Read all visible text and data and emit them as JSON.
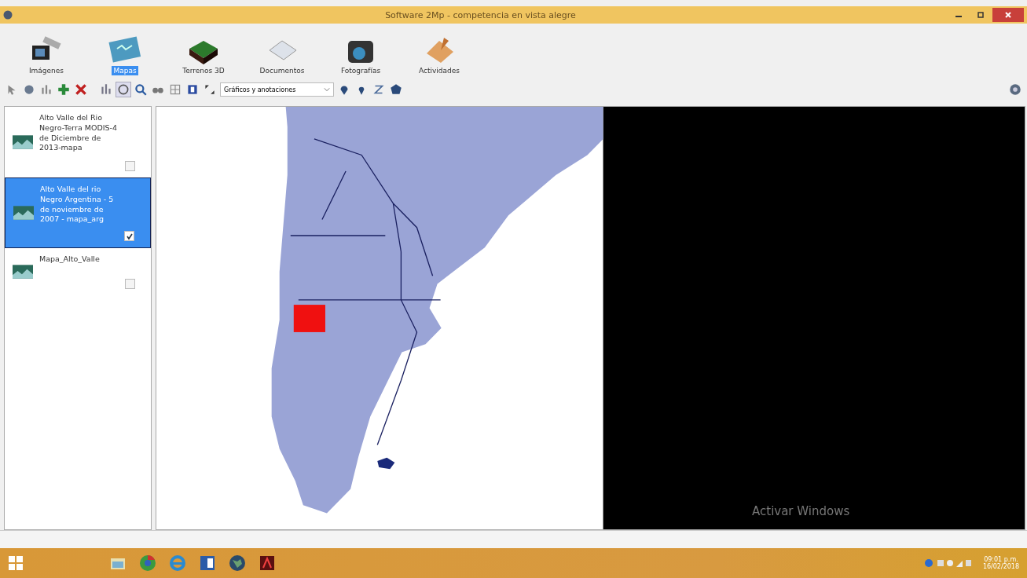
{
  "window": {
    "title": "Software 2Mp - competencia en vista alegre"
  },
  "modules": [
    {
      "label": "Imágenes",
      "kind": "satellite",
      "selected": false
    },
    {
      "label": "Mapas",
      "kind": "map",
      "selected": true
    },
    {
      "label": "Terrenos 3D",
      "kind": "terrain",
      "selected": false
    },
    {
      "label": "Documentos",
      "kind": "document",
      "selected": false
    },
    {
      "label": "Fotografías",
      "kind": "camera",
      "selected": false
    },
    {
      "label": "Actividades",
      "kind": "notebook",
      "selected": false
    }
  ],
  "toolbar": {
    "layer_dropdown": "Gráficos y anotaciones"
  },
  "layers": [
    {
      "title": "Alto Valle del Rio Negro-Terra MODIS-4 de Diciembre de 2013-mapa",
      "checked": false,
      "selected": false
    },
    {
      "title": "Alto Valle del rio Negro Argentina - 5 de noviembre de 2007 - mapa_arg",
      "checked": true,
      "selected": true
    },
    {
      "title": "Mapa_Alto_Valle",
      "checked": false,
      "selected": false
    }
  ],
  "map": {
    "watermark": "Activar Windows"
  },
  "taskbar": {
    "apps": [
      {
        "kind": "files"
      },
      {
        "kind": "chrome"
      },
      {
        "kind": "ie"
      },
      {
        "kind": "word"
      },
      {
        "kind": "globe"
      },
      {
        "kind": "pdf"
      }
    ],
    "time": "09:01 p.m.",
    "date": "16/02/2018"
  }
}
